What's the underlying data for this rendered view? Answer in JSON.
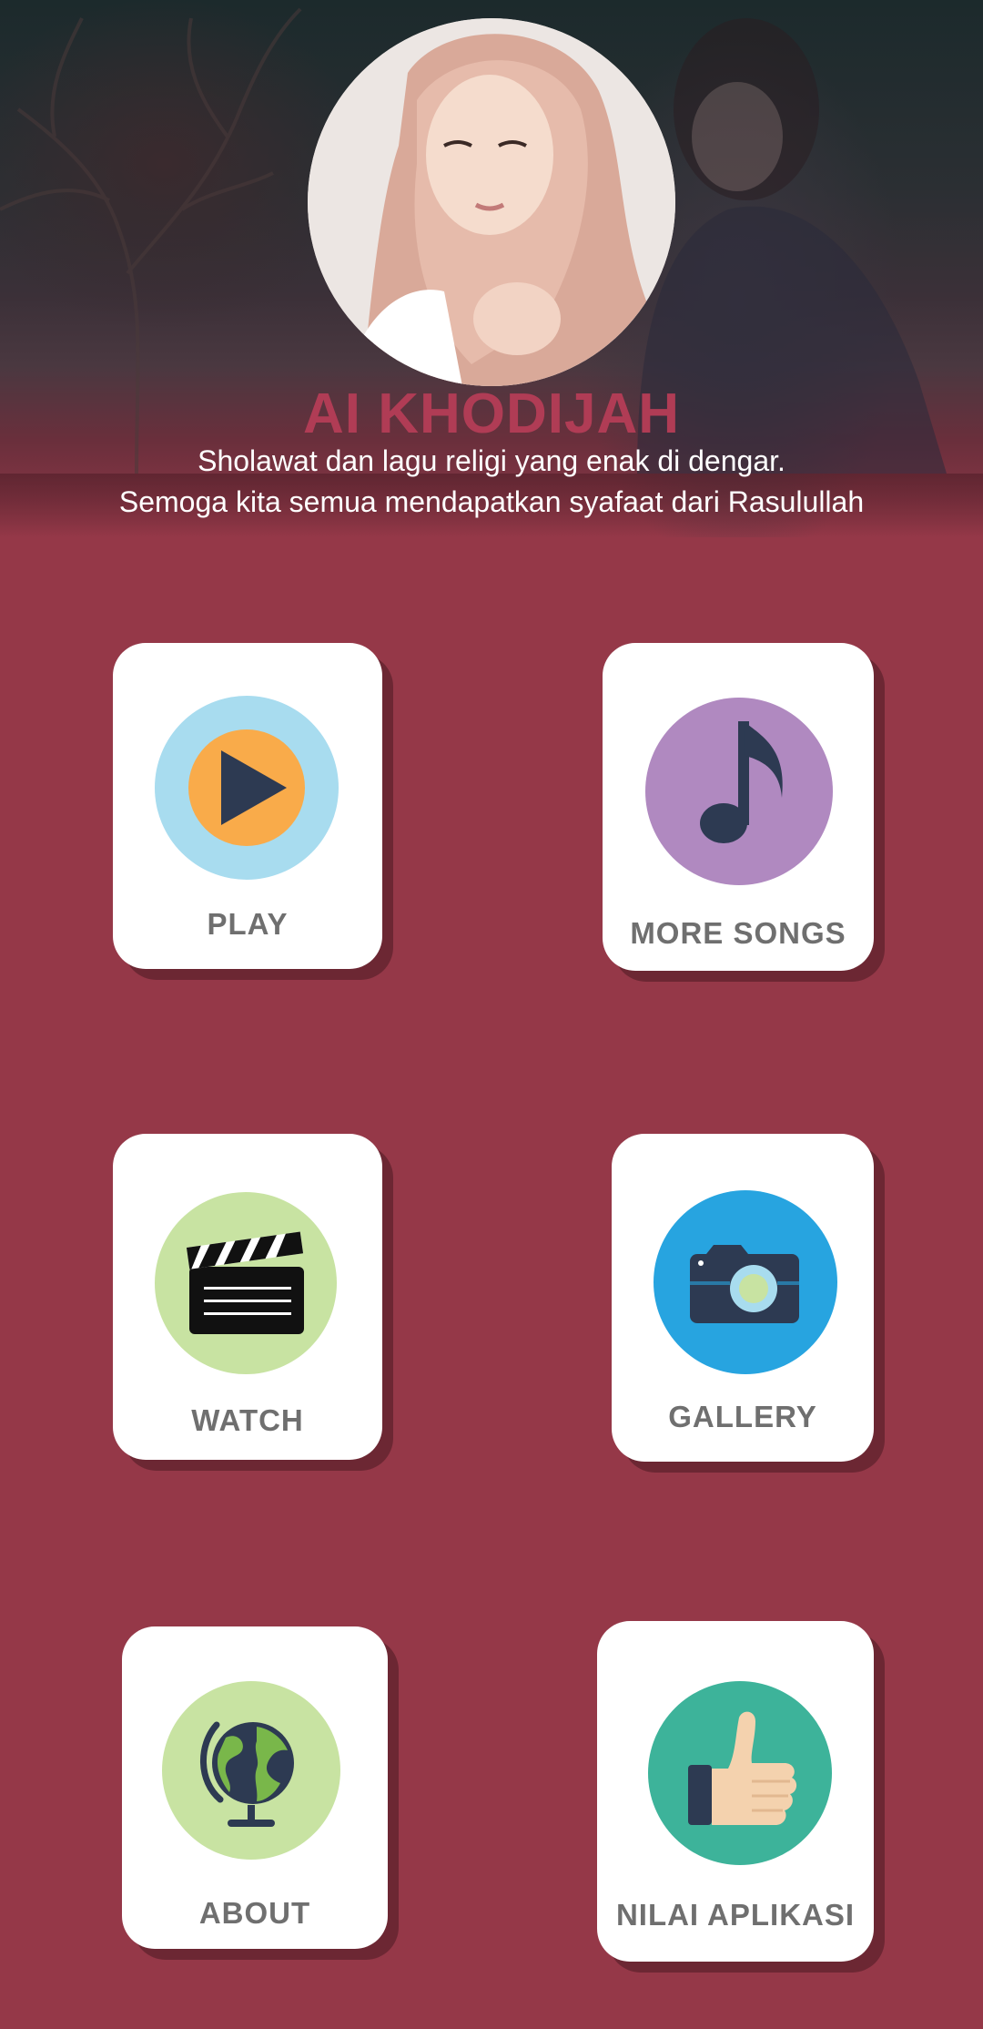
{
  "header": {
    "title": "AI KHODIJAH",
    "subtitle_line1": "Sholawat dan lagu religi yang enak di dengar.",
    "subtitle_line2": "Semoga kita semua mendapatkan syafaat dari Rasulullah"
  },
  "menu": {
    "play": {
      "label": "PLAY",
      "icon": "play-icon",
      "circle_color": "#a8dcef"
    },
    "more_songs": {
      "label": "MORE SONGS",
      "icon": "music-note-icon",
      "circle_color": "#b089c0"
    },
    "watch": {
      "label": "WATCH",
      "icon": "clapperboard-icon",
      "circle_color": "#c8e3a2"
    },
    "gallery": {
      "label": "GALLERY",
      "icon": "camera-icon",
      "circle_color": "#27a4e0"
    },
    "about": {
      "label": "ABOUT",
      "icon": "globe-icon",
      "circle_color": "#c8e3a2"
    },
    "rate_app": {
      "label": "NILAI APLIKASI",
      "icon": "thumbs-up-icon",
      "circle_color": "#3db39a"
    }
  },
  "colors": {
    "background": "#953848",
    "title": "#b03c55",
    "card": "#ffffff",
    "label": "#6f6f6f"
  }
}
